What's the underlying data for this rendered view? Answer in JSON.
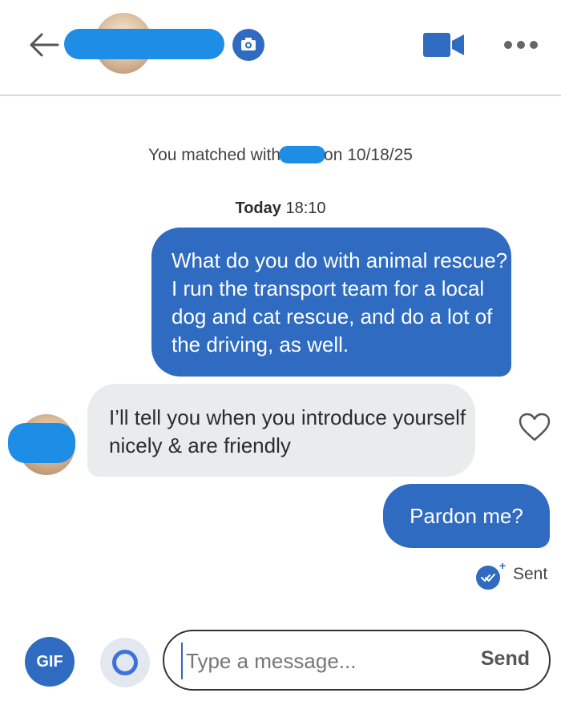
{
  "header": {
    "back_icon": "arrow-left-icon",
    "camera_icon": "camera-icon",
    "video_icon": "video-camera-icon",
    "more_icon": "more-horizontal-icon",
    "accent_color": "#2e6bc1",
    "redaction_color": "#1e8de6"
  },
  "conversation": {
    "match_text_before": "You matched with",
    "match_text_after": "on 10/18/25",
    "day_label": "Today",
    "time_label": "18:10",
    "messages": [
      {
        "direction": "outgoing",
        "text": "What do you do with animal rescue? I run the transport team for a local dog and cat rescue, and do a lot of the driving, as well."
      },
      {
        "direction": "incoming",
        "text": "I’ll tell you when you introduce yourself nicely & are friendly"
      },
      {
        "direction": "outgoing",
        "text": "Pardon me?"
      }
    ],
    "status": "Sent",
    "status_icon": "double-check-icon",
    "like_icon": "heart-outline-icon"
  },
  "composer": {
    "gif_label": "GIF",
    "ring_icon": "ring-icon",
    "placeholder": "Type a message...",
    "send_label": "Send"
  }
}
